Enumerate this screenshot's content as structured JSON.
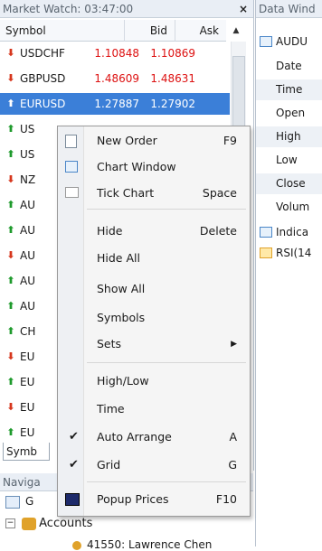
{
  "market_watch": {
    "title": "Market Watch: 03:47:00",
    "close": "×",
    "columns": {
      "symbol": "Symbol",
      "bid": "Bid",
      "ask": "Ask"
    },
    "rows": [
      {
        "symbol": "USDCHF",
        "bid": "1.10848",
        "ask": "1.10869",
        "dir": "down"
      },
      {
        "symbol": "GBPUSD",
        "bid": "1.48609",
        "ask": "1.48631",
        "dir": "down"
      },
      {
        "symbol": "EURUSD",
        "bid": "1.27887",
        "ask": "1.27902",
        "dir": "up",
        "selected": true
      },
      {
        "symbol": "US",
        "dir": "up"
      },
      {
        "symbol": "US",
        "dir": "up"
      },
      {
        "symbol": "NZ",
        "dir": "down"
      },
      {
        "symbol": "AU",
        "dir": "up"
      },
      {
        "symbol": "AU",
        "dir": "up"
      },
      {
        "symbol": "AU",
        "dir": "down"
      },
      {
        "symbol": "AU",
        "dir": "up"
      },
      {
        "symbol": "AU",
        "dir": "up"
      },
      {
        "symbol": "CH",
        "dir": "up"
      },
      {
        "symbol": "EU",
        "dir": "down"
      },
      {
        "symbol": "EU",
        "dir": "up"
      },
      {
        "symbol": "EU",
        "dir": "down"
      },
      {
        "symbol": "EU",
        "dir": "up"
      }
    ],
    "tab": "Symb"
  },
  "navigator": {
    "title": "Naviga",
    "row1": "G",
    "row2": "Accounts",
    "row3": "41550: Lawrence Chen"
  },
  "data_window": {
    "title": "Data Wind",
    "symbol": "AUDU",
    "rows": [
      "Date",
      "Time",
      "Open",
      "High",
      "Low",
      "Close",
      "Volum"
    ],
    "indicators": "Indica",
    "rsi": "RSI(14"
  },
  "context_menu": {
    "new_order": "New Order",
    "new_order_sc": "F9",
    "chart_window": "Chart Window",
    "tick_chart": "Tick Chart",
    "tick_chart_sc": "Space",
    "hide": "Hide",
    "hide_sc": "Delete",
    "hide_all": "Hide All",
    "show_all": "Show All",
    "symbols": "Symbols",
    "sets": "Sets",
    "high_low": "High/Low",
    "time": "Time",
    "auto_arrange": "Auto Arrange",
    "auto_arrange_sc": "A",
    "grid": "Grid",
    "grid_sc": "G",
    "popup_prices": "Popup Prices",
    "popup_prices_sc": "F10"
  },
  "colors": {
    "up": "#1e9a2c",
    "down": "#d6361c",
    "selection": "#3b7fd8",
    "price": "#d11111"
  }
}
